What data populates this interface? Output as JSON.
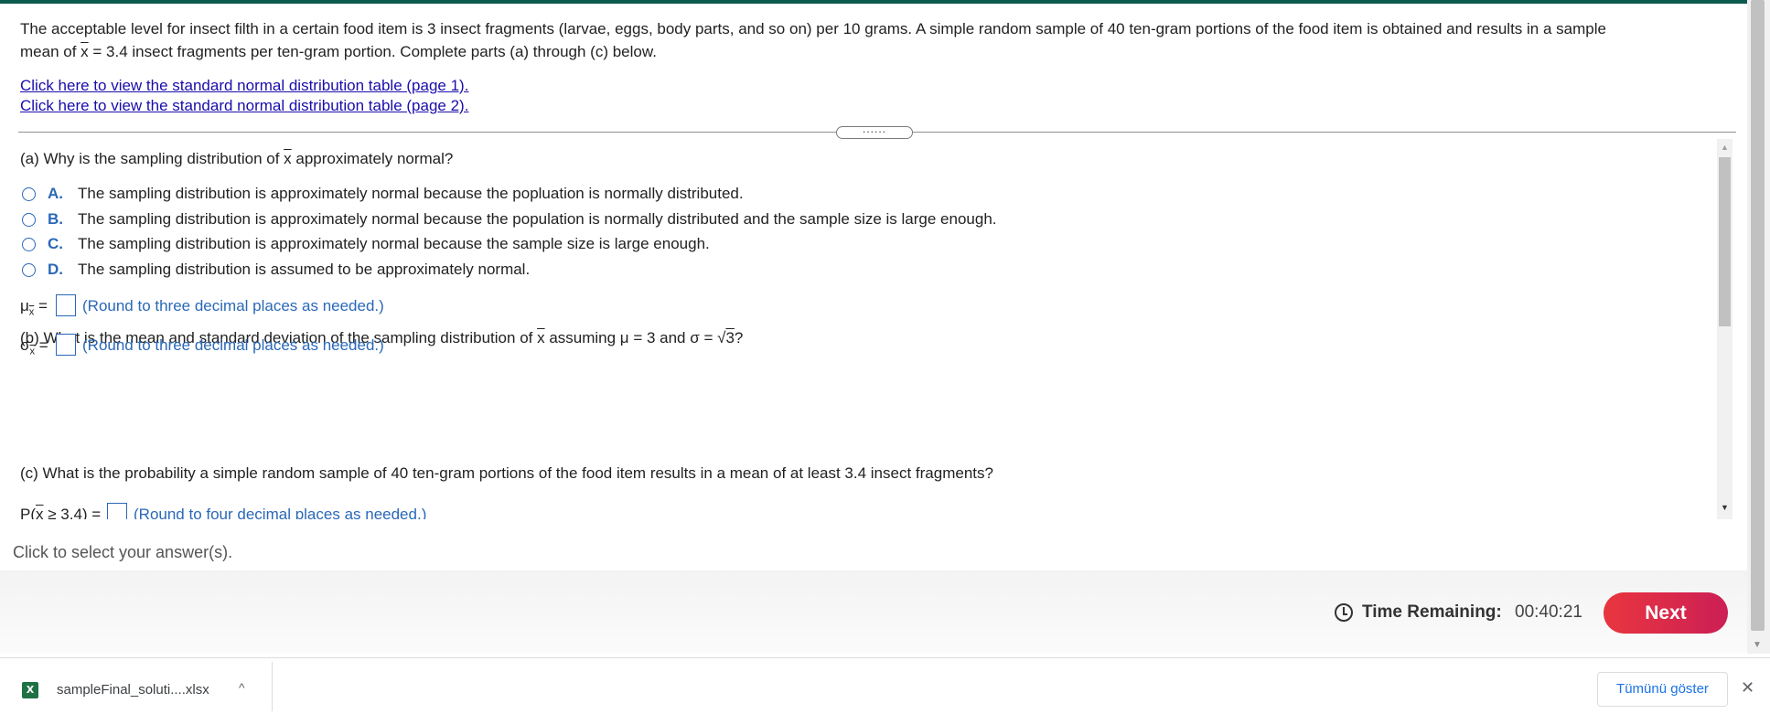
{
  "question": {
    "line1": "The acceptable level for insect filth in a certain food item is 3 insect fragments (larvae, eggs, body parts, and so on) per 10 grams. A simple random sample of 40 ten-gram portions of the food item is obtained and results in a sample",
    "line2_pre": "mean of ",
    "line2_var": "x",
    "line2_post": " = 3.4 insect fragments per ten-gram portion. Complete parts (a) through (c) below."
  },
  "links": {
    "table1": "Click here to view the standard normal distribution table (page 1).",
    "table2": "Click here to view the standard normal distribution table (page 2)."
  },
  "divider_handle": "......",
  "part_a": {
    "pre": "(a) Why is the sampling distribution of ",
    "var": "x",
    "post": " approximately normal?",
    "options": [
      {
        "letter": "A.",
        "text": "The sampling distribution is approximately normal because the popluation is normally distributed."
      },
      {
        "letter": "B.",
        "text": "The sampling distribution is approximately normal because the population is normally distributed and the sample size is large enough."
      },
      {
        "letter": "C.",
        "text": "The sampling distribution is approximately normal because the sample size is large enough."
      },
      {
        "letter": "D.",
        "text": "The sampling distribution is assumed to be approximately normal."
      }
    ]
  },
  "part_b": {
    "pre": "(b) What is the mean and standard deviation of the sampling distribution of ",
    "var": "x",
    "post": " assuming μ = 3 and σ = ",
    "sqrt_sign": "√",
    "sqrt_arg": "3",
    "end": "?",
    "mu_symbol": "μ",
    "mu_sub": "x",
    "sigma_symbol": "σ",
    "sigma_sub": "x",
    "equals": " =",
    "hint": "(Round to three decimal places as needed.)"
  },
  "part_c": {
    "question": "(c) What is the probability a simple random sample of 40 ten-gram portions of the food item results in a mean of at least 3.4 insect fragments?",
    "p_pre": "P(",
    "p_var": "x",
    "p_post": " ≥ 3.4) =",
    "hint": "(Round to four decimal places as needed.)"
  },
  "click_hint": "Click to select your answer(s).",
  "timer": {
    "label": "Time Remaining:",
    "value": "00:40:21"
  },
  "next_label": "Next",
  "download": {
    "filename": "sampleFinal_soluti....xlsx",
    "file_icon_letter": "X",
    "caret": "^",
    "show_all": "Tümünü göster",
    "close": "✕"
  },
  "colors": {
    "accent": "#2a68b8",
    "link": "#1a0dab",
    "next": "#e8363f",
    "topbar": "#0b5a4e"
  }
}
